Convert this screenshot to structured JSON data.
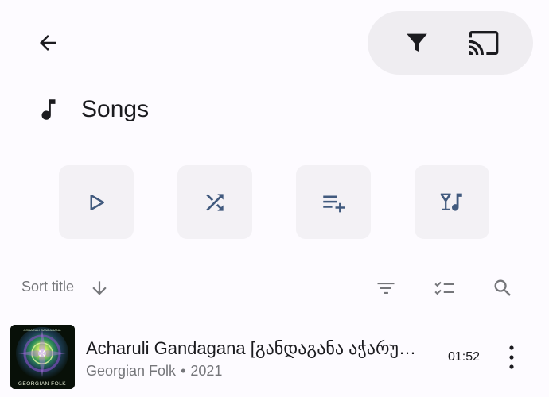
{
  "header": {
    "back_icon": "arrow-left-icon",
    "actions": [
      {
        "icon": "filter-icon"
      },
      {
        "icon": "cast-icon"
      }
    ]
  },
  "heading": {
    "icon": "music-note-icon",
    "title": "Songs"
  },
  "action_buttons": [
    {
      "icon": "play-icon"
    },
    {
      "icon": "shuffle-icon"
    },
    {
      "icon": "playlist-add-icon"
    },
    {
      "icon": "party-mode-icon"
    }
  ],
  "sort_bar": {
    "label": "Sort title",
    "direction_icon": "arrow-down-icon",
    "tools": [
      {
        "icon": "sort-lines-icon"
      },
      {
        "icon": "checklist-icon"
      },
      {
        "icon": "search-icon"
      }
    ]
  },
  "songs": [
    {
      "title": "Acharuli Gandagana [განდაგანა აჭარული]",
      "artist": "Georgian Folk",
      "separator": "•",
      "year": "2021",
      "duration": "01:52",
      "cover_caption": "GEORGIAN FOLK",
      "cover_top_text": "ACHARULI GANDAGANA"
    }
  ],
  "colors": {
    "background": "#fdfbff",
    "pill": "#efedf1",
    "action_button_bg": "#f3f1f5",
    "accent_icon": "#415a7e",
    "secondary_text": "#75767a"
  }
}
